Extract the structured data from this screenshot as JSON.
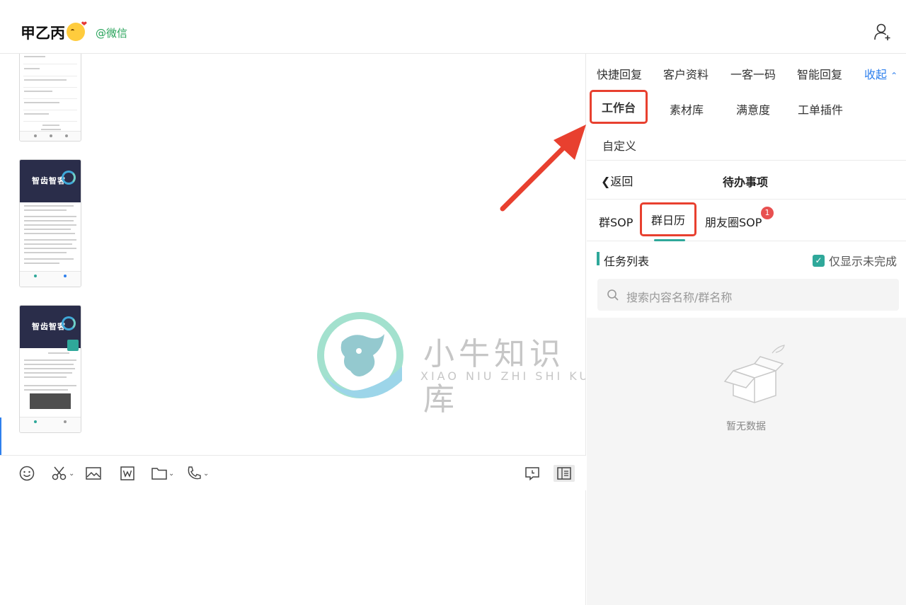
{
  "header": {
    "contact_name": "甲乙丙",
    "channel_label": "@微信"
  },
  "watermark": {
    "title": "小牛知识库",
    "subtitle": "XIAO NIU ZHI SHI KU"
  },
  "thumbnails": [
    {
      "banner_text": ""
    },
    {
      "banner_text": "智齿智客"
    },
    {
      "banner_text": "智齿智客"
    }
  ],
  "toolbar": {
    "items": [
      "emoji-icon",
      "scissors-icon",
      "image-icon",
      "word-file-icon",
      "folder-icon",
      "phone-icon",
      "comment-icon",
      "sidebar-panel-icon"
    ]
  },
  "right_panel": {
    "tabs_row1": [
      "快捷回复",
      "客户资料",
      "一客一码",
      "智能回复"
    ],
    "collapse_label": "收起",
    "tabs_row2": [
      "工作台",
      "素材库",
      "满意度",
      "工单插件"
    ],
    "tabs_row3": [
      "自定义"
    ],
    "back_label": "返回",
    "todo_title": "待办事项",
    "subtabs": [
      "群SOP",
      "群日历",
      "朋友圈SOP"
    ],
    "subtab_badge": "1",
    "task_list_title": "任务列表",
    "filter_label": "仅显示未完成",
    "search_placeholder": "搜索内容名称/群名称",
    "empty_text": "暂无数据"
  },
  "colors": {
    "accent_teal": "#2fa89a",
    "link_blue": "#2f80ed",
    "highlight_red": "#e8402f",
    "channel_green": "#27a35a"
  }
}
